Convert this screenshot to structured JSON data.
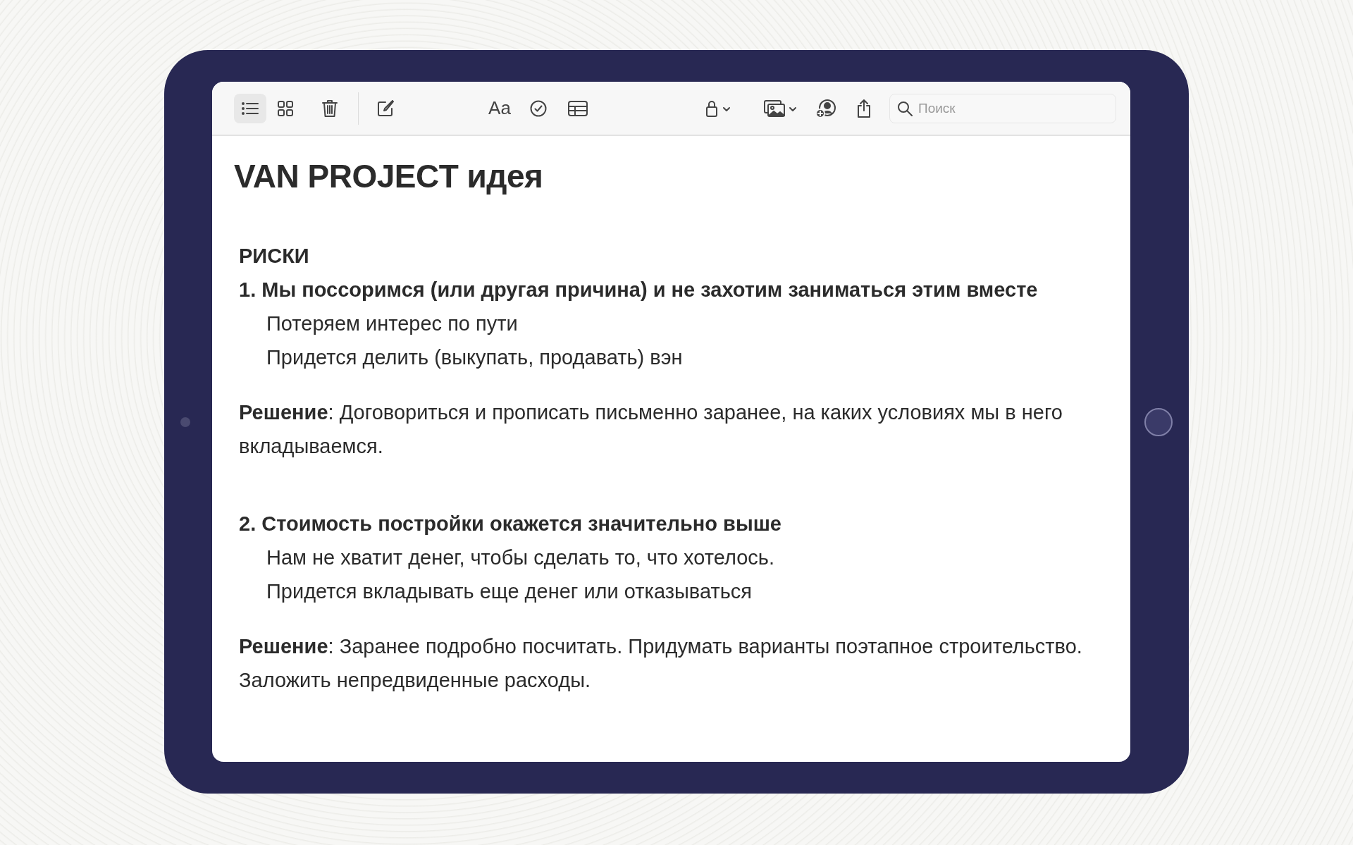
{
  "toolbar": {
    "views": [
      {
        "kind": "list",
        "selected": true
      },
      {
        "kind": "gallery",
        "selected": false
      }
    ],
    "format_label": "Aa",
    "search": {
      "placeholder": "Поиск"
    }
  },
  "note": {
    "title": "VAN PROJECT идея",
    "blocks": [
      {
        "kind": "heading",
        "text": "РИСКИ"
      },
      {
        "kind": "numbered",
        "text": "1. Мы поссоримся (или другая причина) и не захотим заниматься этим вместе"
      },
      {
        "kind": "indent",
        "text": "Потеряем интерес по пути"
      },
      {
        "kind": "indent",
        "text": "Придется делить (выкупать, продавать) вэн"
      },
      {
        "kind": "paragraph",
        "text": "**Решение**: Договориться и прописать письменно заранее, на каких условиях мы в него вкладываемся."
      },
      {
        "kind": "numbered",
        "text": "2. Стоимость постройки окажется значительно выше"
      },
      {
        "kind": "indent",
        "text": "Нам не хватит денег, чтобы сделать то, что хотелось."
      },
      {
        "kind": "indent",
        "text": "Придется вкладывать еще денег или отказываться"
      },
      {
        "kind": "paragraph",
        "text": "**Решение**: Заранее подробно посчитать. Придумать варианты поэтапное строительство. Заложить непредвиденные расходы."
      }
    ]
  }
}
